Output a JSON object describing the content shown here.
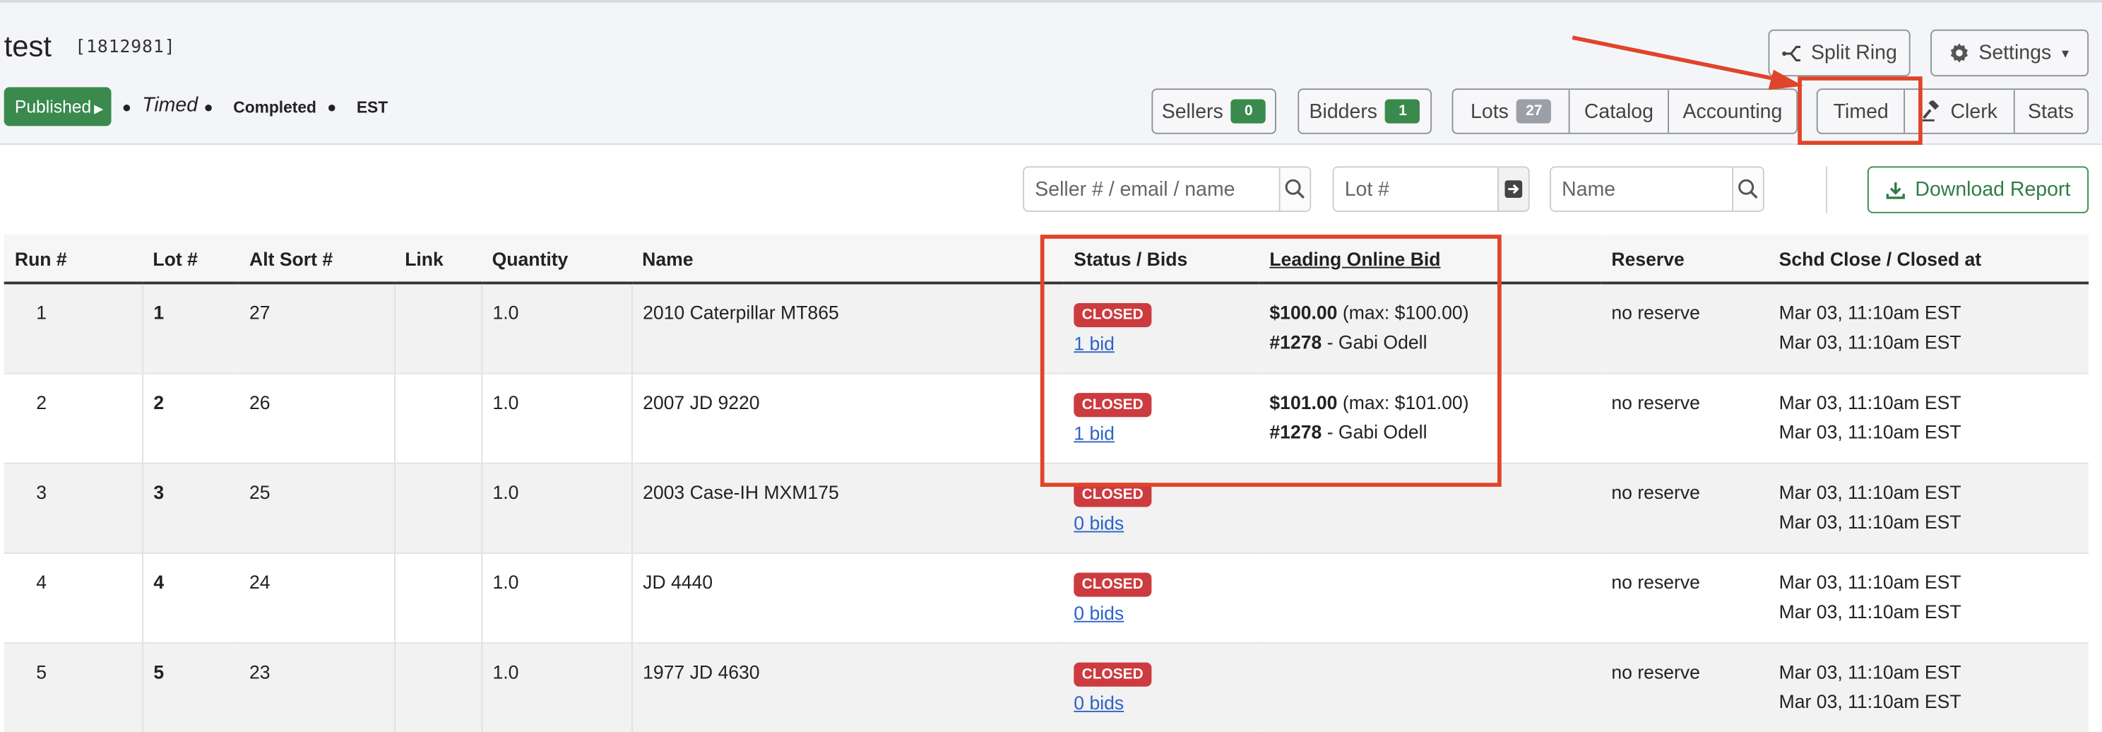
{
  "header": {
    "title": "test",
    "auction_id": "[1812981]",
    "published_label": "Published",
    "type_label": "Timed",
    "status_label": "Completed",
    "timezone_label": "EST",
    "split_ring_label": "Split Ring",
    "settings_label": "Settings",
    "sellers_label": "Sellers",
    "sellers_count": "0",
    "bidders_label": "Bidders",
    "bidders_count": "1",
    "lots_label": "Lots",
    "lots_count": "27",
    "catalog_label": "Catalog",
    "accounting_label": "Accounting",
    "timed_label": "Timed",
    "clerk_label": "Clerk",
    "stats_label": "Stats"
  },
  "filters": {
    "seller_placeholder": "Seller # / email / name",
    "lot_placeholder": "Lot #",
    "name_placeholder": "Name",
    "download_label": "Download Report"
  },
  "table": {
    "columns": [
      "Run #",
      "Lot #",
      "Alt Sort #",
      "Link",
      "Quantity",
      "Name",
      "Status / Bids",
      "Leading Online Bid",
      "Reserve",
      "Schd Close / Closed at"
    ],
    "rows": [
      {
        "run": "1",
        "lot": "1",
        "alt": "27",
        "link": "",
        "qty": "1.0",
        "name": "2010 Caterpillar MT865",
        "status": "CLOSED",
        "bids": "1 bid",
        "bid_amount": "$100.00",
        "bid_max": "(max: $100.00)",
        "bidder_num": "#1278",
        "bidder_name": "- Gabi Odell",
        "reserve": "no reserve",
        "close1": "Mar 03, 11:10am EST",
        "close2": "Mar 03, 11:10am EST"
      },
      {
        "run": "2",
        "lot": "2",
        "alt": "26",
        "link": "",
        "qty": "1.0",
        "name": "2007 JD 9220",
        "status": "CLOSED",
        "bids": "1 bid",
        "bid_amount": "$101.00",
        "bid_max": "(max: $101.00)",
        "bidder_num": "#1278",
        "bidder_name": "- Gabi Odell",
        "reserve": "no reserve",
        "close1": "Mar 03, 11:10am EST",
        "close2": "Mar 03, 11:10am EST"
      },
      {
        "run": "3",
        "lot": "3",
        "alt": "25",
        "link": "",
        "qty": "1.0",
        "name": "2003 Case-IH MXM175",
        "status": "CLOSED",
        "bids": "0 bids",
        "bid_amount": "",
        "bid_max": "",
        "bidder_num": "",
        "bidder_name": "",
        "reserve": "no reserve",
        "close1": "Mar 03, 11:10am EST",
        "close2": "Mar 03, 11:10am EST"
      },
      {
        "run": "4",
        "lot": "4",
        "alt": "24",
        "link": "",
        "qty": "1.0",
        "name": "JD 4440",
        "status": "CLOSED",
        "bids": "0 bids",
        "bid_amount": "",
        "bid_max": "",
        "bidder_num": "",
        "bidder_name": "",
        "reserve": "no reserve",
        "close1": "Mar 03, 11:10am EST",
        "close2": "Mar 03, 11:10am EST"
      },
      {
        "run": "5",
        "lot": "5",
        "alt": "23",
        "link": "",
        "qty": "1.0",
        "name": "1977 JD 4630",
        "status": "CLOSED",
        "bids": "0 bids",
        "bid_amount": "",
        "bid_max": "",
        "bidder_num": "",
        "bidder_name": "",
        "reserve": "no reserve",
        "close1": "Mar 03, 11:10am EST",
        "close2": "Mar 03, 11:10am EST"
      }
    ]
  },
  "colors": {
    "green": "#3a8a4e",
    "red_badge": "#cc3b3f",
    "link_blue": "#2b62c8",
    "annotation_red": "#e0442a"
  }
}
